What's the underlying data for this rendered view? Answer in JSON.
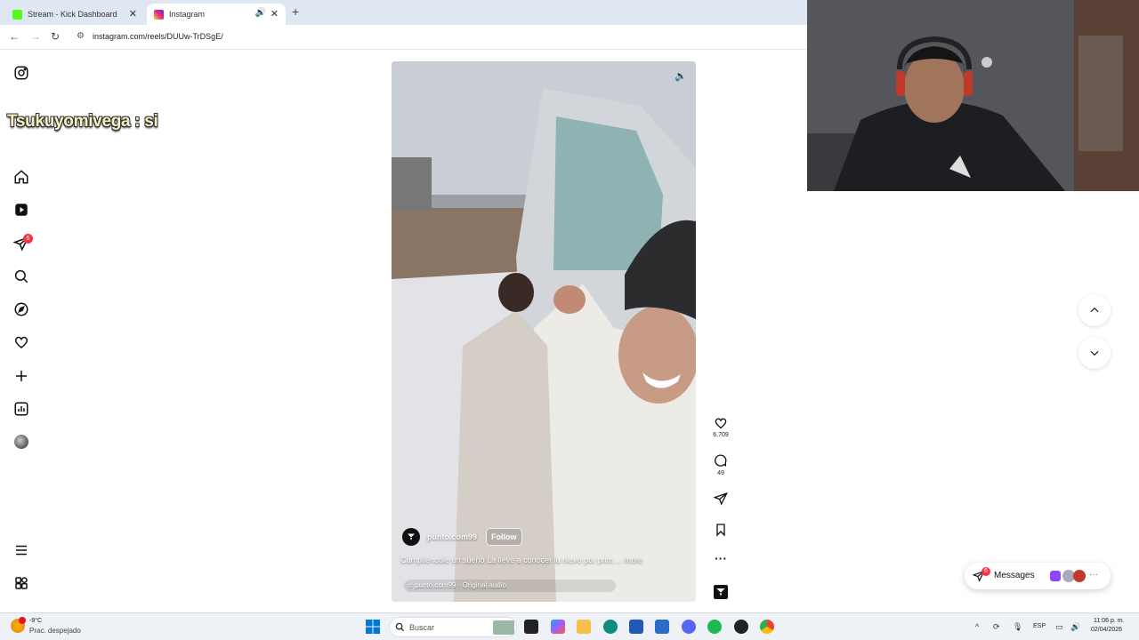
{
  "browser": {
    "tabs": [
      {
        "title": "Stream - Kick Dashboard",
        "favicon_color": "#53fc18",
        "active": false
      },
      {
        "title": "Instagram",
        "favicon_color": "#e1306c",
        "active": true
      }
    ],
    "url": "instagram.com/reels/DUUw-TrDSgE/"
  },
  "overlay": {
    "chat_message": "Tsukuyomivega : si"
  },
  "sidebar": {
    "notifications_badge": "6"
  },
  "reel": {
    "username": "punto.com99",
    "follow_label": "Follow",
    "caption": "Cumpliéndole un sueño La llevé a conocer la nieve por prim",
    "caption_more": "... more",
    "audio": "punto.com99 · Original audio",
    "likes": "6,709",
    "comments": "49"
  },
  "messages": {
    "label": "Messages",
    "badge": "6"
  },
  "taskbar": {
    "weather_temp": "-9°C",
    "weather_desc": "Prac. despejado",
    "search_label": "Buscar",
    "language": "ESP",
    "time": "11:06 p. m.",
    "date": "02/04/2026"
  }
}
